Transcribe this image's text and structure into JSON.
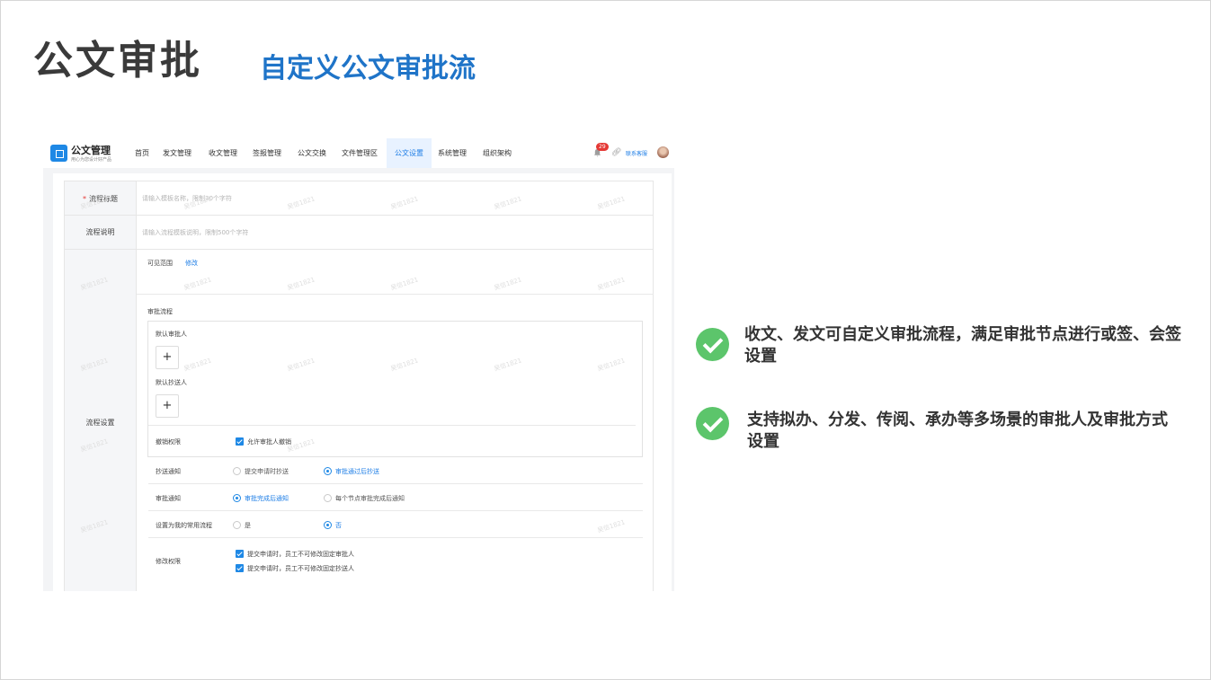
{
  "slide": {
    "title": "公文审批",
    "subtitle": "自定义公文审批流"
  },
  "app": {
    "name": "公文管理",
    "tagline": "用心为您设计好产品",
    "nav": [
      "首页",
      "发文管理",
      "收文管理",
      "签报管理",
      "公文交换",
      "文件管理区",
      "公文设置",
      "系统管理",
      "组织架构"
    ],
    "active_nav": "公文设置",
    "notification_count": "29",
    "contact_label": "联系客服",
    "accent_color": "#1e88e5"
  },
  "form": {
    "flow_title_label": "流程标题",
    "flow_title_placeholder": "请输入模板名称，限制30个字符",
    "flow_desc_label": "流程说明",
    "flow_desc_placeholder": "请输入流程模板说明，限制500个字符",
    "settings_label": "流程设置",
    "visible_scope_label": "可见范围",
    "visible_scope_edit": "修改",
    "approval_flow_label": "审批流程",
    "default_approver_label": "默认审批人",
    "default_cc_label": "默认抄送人",
    "plus": "+",
    "revoke_label": "撤销权限",
    "revoke_option": "允许审批人撤销",
    "cc_notify_label": "抄送通知",
    "cc_notify_options": [
      "提交申请时抄送",
      "审批通过后抄送"
    ],
    "cc_notify_selected": "审批通过后抄送",
    "approve_notify_label": "审批通知",
    "approve_notify_options": [
      "审批完成后通知",
      "每个节点审批完成后通知"
    ],
    "approve_notify_selected": "审批完成后通知",
    "common_flow_label": "设置为我的常用流程",
    "common_flow_options": [
      "是",
      "否"
    ],
    "common_flow_selected": "否",
    "modify_label": "修改权限",
    "modify_options": [
      "提交申请时，员工不可修改固定审批人",
      "提交申请时，员工不可修改固定抄送人"
    ],
    "watermark": "吴信1821"
  },
  "features": [
    "收文、发文可自定义审批流程，满足审批节点进行或签、会签设置",
    "支持拟办、分发、传阅、承办等多场景的审批人及审批方式设置"
  ]
}
